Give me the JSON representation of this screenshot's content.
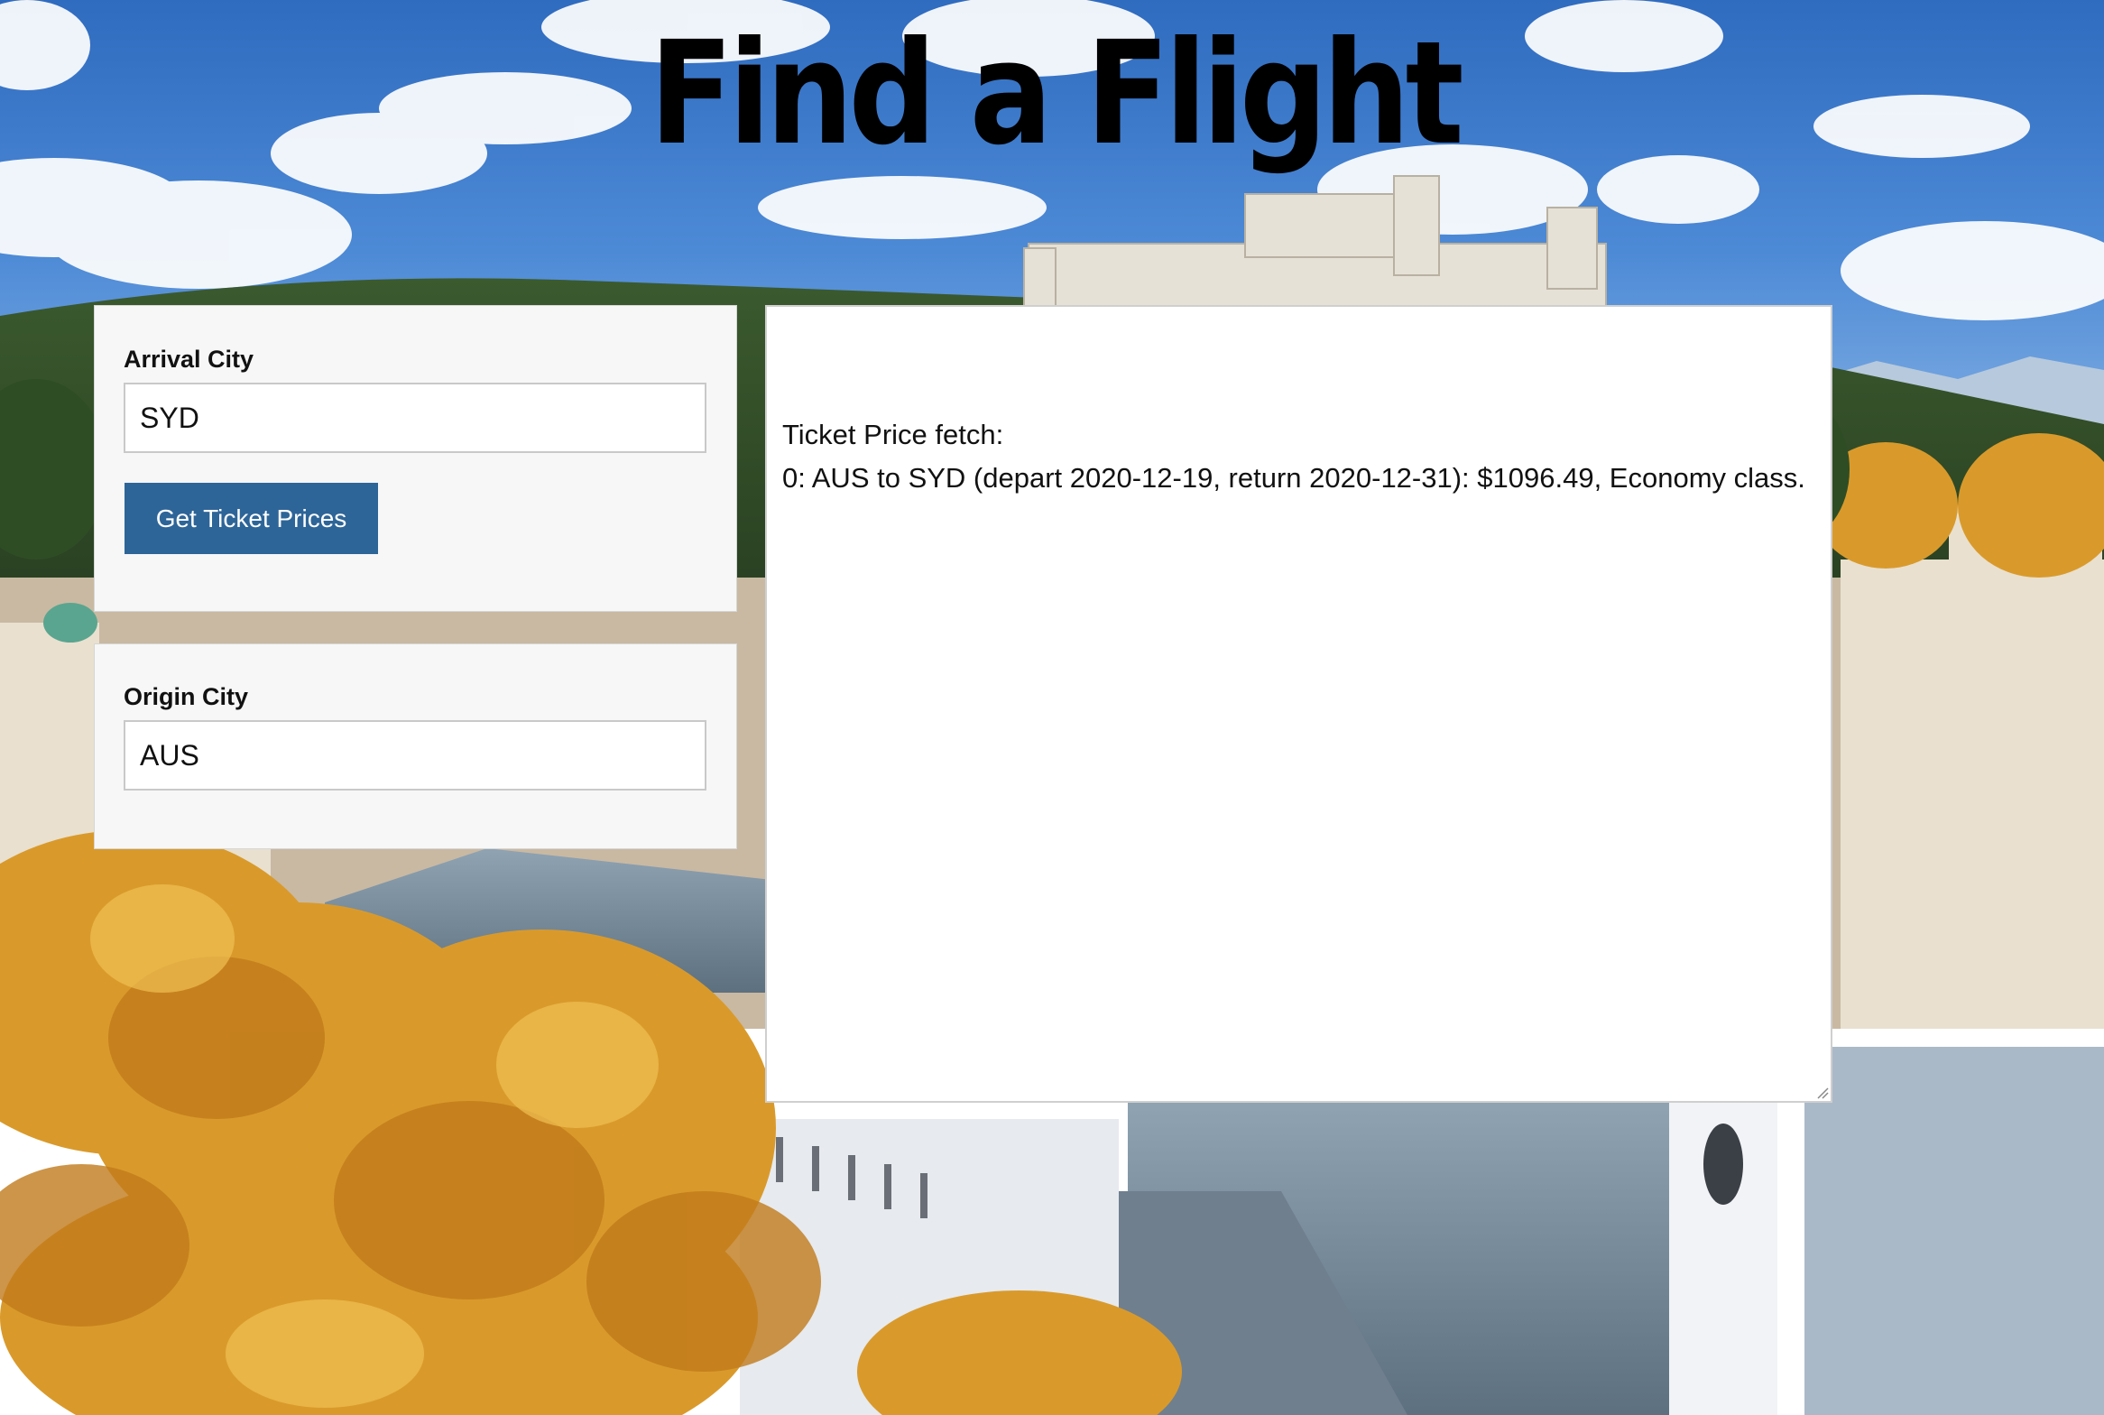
{
  "page": {
    "title": "Find a Flight"
  },
  "arrival": {
    "label": "Arrival City",
    "value": "SYD"
  },
  "actions": {
    "get_prices_label": "Get Ticket Prices"
  },
  "origin": {
    "label": "Origin City",
    "value": "AUS"
  },
  "results": {
    "heading": "Ticket Price fetch:",
    "lines": [
      "0: AUS to SYD (depart 2020-12-19, return 2020-12-31): $1096.49, Economy class."
    ]
  },
  "colors": {
    "button": "#2e6598",
    "panel": "#f7f7f7",
    "sky": "#3f7bc6"
  }
}
